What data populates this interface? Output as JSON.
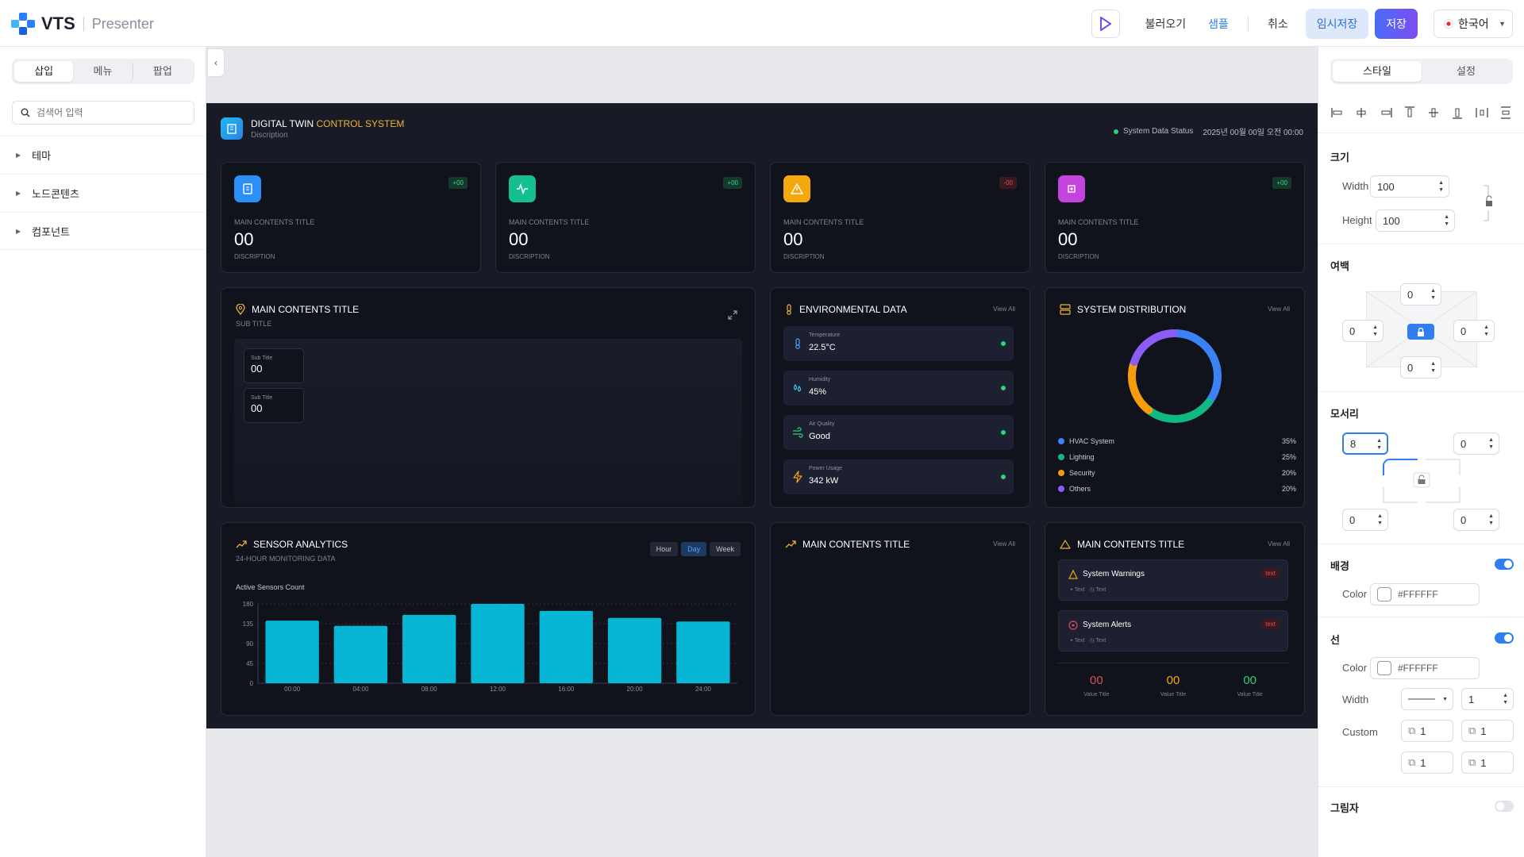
{
  "topbar": {
    "brand": "VTS",
    "product": "Presenter",
    "load_label": "불러오기",
    "sample_label": "샘플",
    "cancel_label": "취소",
    "draft_label": "임시저장",
    "save_label": "저장",
    "language": "한국어"
  },
  "left": {
    "tabs": [
      "삽입",
      "메뉴",
      "팝업"
    ],
    "search_placeholder": "검색어 입력",
    "tree": [
      "테마",
      "노드콘텐츠",
      "컴포넌트"
    ]
  },
  "right": {
    "tabs": [
      "스타일",
      "설정"
    ],
    "size_label": "크기",
    "width_label": "Width",
    "width_value": "100",
    "height_label": "Height",
    "height_value": "100",
    "padding_label": "여백",
    "padding": {
      "top": "0",
      "left": "0",
      "right": "0",
      "bottom": "0"
    },
    "corner_label": "모서리",
    "corner": {
      "tl": "8",
      "tr": "0",
      "bl": "0",
      "br": "0"
    },
    "bg_label": "배경",
    "color_label": "Color",
    "bg_color": "#FFFFFF",
    "line_label": "선",
    "line_color": "#FFFFFF",
    "line_width_label": "Width",
    "line_width": "1",
    "custom_label": "Custom",
    "custom": [
      "1",
      "1",
      "1",
      "1"
    ],
    "shadow_label": "그림자"
  },
  "dashboard": {
    "title_a": "DIGITAL TWIN ",
    "title_b": "CONTROL SYSTEM",
    "description": "Discription",
    "status_label": "System Data Status",
    "datetime": "2025년 00월 00일 오전 00:00",
    "kpis": [
      {
        "badge": "+00",
        "title": "MAIN CONTENTS TITLE",
        "value": "00",
        "desc": "DISCRIPTION",
        "color": "#2b8ff5"
      },
      {
        "badge": "+00",
        "title": "MAIN CONTENTS TITLE",
        "value": "00",
        "desc": "DISCRIPTION",
        "color": "#13c08e"
      },
      {
        "badge": "-00",
        "title": "MAIN CONTENTS TITLE",
        "value": "00",
        "desc": "DISCRIPTION",
        "color": "#f5a70e"
      },
      {
        "badge": "+00",
        "title": "MAIN CONTENTS TITLE",
        "value": "00",
        "desc": "DISCRIPTION",
        "color": "#c544e0"
      }
    ],
    "map_card": {
      "title": "MAIN CONTENTS TITLE",
      "subtitle": "SUB TITLE",
      "minis": [
        {
          "label": "Sub Title",
          "value": "00"
        },
        {
          "label": "Sub Title",
          "value": "00"
        }
      ]
    },
    "env": {
      "title": "ENVIRONMENTAL DATA",
      "link": "View All",
      "rows": [
        {
          "label": "Temperature",
          "value": "22.5°C"
        },
        {
          "label": "Humidity",
          "value": "45%"
        },
        {
          "label": "Air Quality",
          "value": "Good"
        },
        {
          "label": "Power Usage",
          "value": "342 kW"
        }
      ]
    },
    "dist": {
      "title": "SYSTEM DISTRIBUTION",
      "link": "View All",
      "items": [
        {
          "name": "HVAC System",
          "pct": "35%",
          "value": 35,
          "color": "#3b82f6"
        },
        {
          "name": "Lighting",
          "pct": "25%",
          "value": 25,
          "color": "#10b981"
        },
        {
          "name": "Security",
          "pct": "20%",
          "value": 20,
          "color": "#f59e0b"
        },
        {
          "name": "Others",
          "pct": "20%",
          "value": 20,
          "color": "#8b5cf6"
        }
      ]
    },
    "sensor": {
      "title": "SENSOR ANALYTICS",
      "subtitle": "24-HOUR MONITORING DATA",
      "ranges": [
        "Hour",
        "Day",
        "Week"
      ],
      "active_range": "Day",
      "chart_label": "Active Sensors Count"
    },
    "blank_card": {
      "title": "MAIN CONTENTS TITLE",
      "link": "View All"
    },
    "alerts": {
      "title": "MAIN CONTENTS TITLE",
      "link": "View All",
      "items": [
        {
          "title": "System Warnings",
          "tag": "text",
          "meta_a": "Text",
          "meta_b": "Text"
        },
        {
          "title": "System Alerts",
          "tag": "text",
          "meta_a": "Text",
          "meta_b": "Text"
        }
      ],
      "values": [
        {
          "value": "00",
          "label": "Value Title",
          "color": "#e04a56"
        },
        {
          "value": "00",
          "label": "Value Title",
          "color": "#f5a70e"
        },
        {
          "value": "00",
          "label": "Value Title",
          "color": "#2ecf7a"
        }
      ]
    }
  },
  "chart_data": {
    "type": "bar",
    "title": "Active Sensors Count",
    "categories": [
      "00:00",
      "04:00",
      "08:00",
      "12:00",
      "16:00",
      "20:00",
      "24:00"
    ],
    "values": [
      142,
      130,
      155,
      180,
      164,
      148,
      140
    ],
    "yticks": [
      0,
      45,
      90,
      135,
      180
    ],
    "ylim": [
      0,
      180
    ],
    "color": "#06b6d4"
  }
}
